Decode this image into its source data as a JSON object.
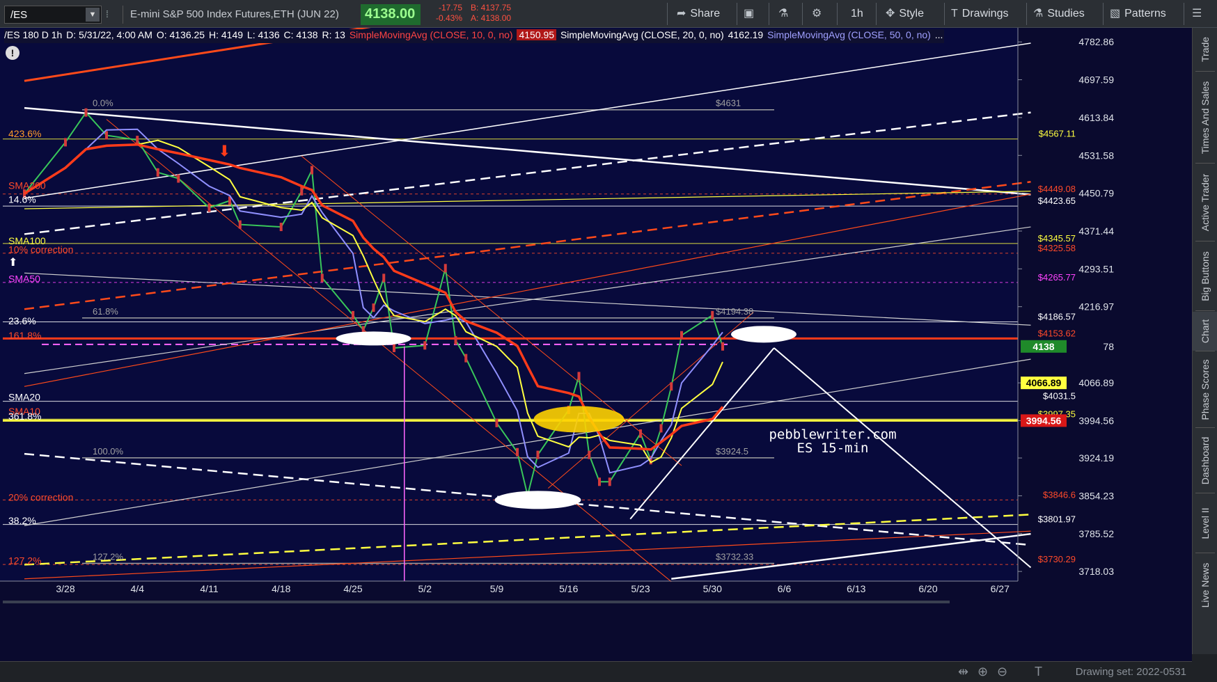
{
  "toolbar": {
    "symbol": "/ES",
    "description": "E-mini S&P 500 Index Futures,ETH (JUN 22)",
    "last": "4138.00",
    "change": "-17.75",
    "change_pct": "-0.43%",
    "bid": "B: 4137.75",
    "ask": "A: 4138.00",
    "share": "Share",
    "timeframe": "1h",
    "style": "Style",
    "drawings": "Drawings",
    "studies": "Studies",
    "patterns": "Patterns"
  },
  "info": {
    "symbol_period": "/ES 180 D 1h",
    "date": "D: 5/31/22, 4:00 AM",
    "open": "O: 4136.25",
    "high": "H: 4149",
    "low": "L: 4136",
    "close": "C: 4138",
    "range": "R: 13",
    "sma10_label": "SimpleMovingAvg (CLOSE, 10, 0, no)",
    "sma10_value": "4150.95",
    "sma20_label": "SimpleMovingAvg (CLOSE, 20, 0, no)",
    "sma20_value": "4162.19",
    "sma50_label": "SimpleMovingAvg (CLOSE, 50, 0, no)"
  },
  "watermark": [
    "pebblewriter.com",
    "ES 15-min"
  ],
  "side_tabs": [
    "Trade",
    "Times And Sales",
    "Active Trader",
    "Big Buttons",
    "Chart",
    "Phase Scores",
    "Dashboard",
    "Level II",
    "Live News"
  ],
  "drawing_set": "Drawing set: 2022-0531",
  "colors": {
    "background": "#080a3c",
    "sma10": "#9090ff",
    "sma20": "#ffff40",
    "sma50": "#ff3b1a",
    "last_price_tag": "#1f8a2a",
    "highlight": "#ffd200"
  },
  "chart_data": {
    "type": "candlestick",
    "x_ticks": [
      "3/28",
      "4/4",
      "4/11",
      "4/18",
      "4/25",
      "5/2",
      "5/9",
      "5/16",
      "5/23",
      "5/30",
      "6/6",
      "6/13",
      "6/20",
      "6/27"
    ],
    "y_ticks": [
      4782.86,
      4697.59,
      4613.84,
      4531.58,
      4450.79,
      4371.44,
      4293.51,
      4216.97,
      4066.89,
      3994.56,
      3924.19,
      3854.23,
      3785.52,
      3718.03
    ],
    "y_scale": "log",
    "ylim": [
      3701,
      4815
    ],
    "xlim": [
      "3/24",
      "6/30"
    ],
    "price_tags": [
      {
        "value": 4138,
        "label": "4138",
        "suffix": "78",
        "color": "#1f8a2a"
      },
      {
        "value": 4066.89,
        "label": "4066.89",
        "color": "#ffff40"
      },
      {
        "value": 3994.56,
        "label": "3994.56",
        "color": "#d81818"
      }
    ],
    "price_series": [
      {
        "date": "3/24",
        "close": 4450
      },
      {
        "date": "3/28",
        "close": 4560
      },
      {
        "date": "3/30",
        "close": 4625
      },
      {
        "date": "4/1",
        "close": 4575
      },
      {
        "date": "4/4",
        "close": 4565
      },
      {
        "date": "4/6",
        "close": 4495
      },
      {
        "date": "4/8",
        "close": 4482
      },
      {
        "date": "4/11",
        "close": 4420
      },
      {
        "date": "4/13",
        "close": 4435
      },
      {
        "date": "4/14",
        "close": 4385
      },
      {
        "date": "4/18",
        "close": 4380
      },
      {
        "date": "4/20",
        "close": 4455
      },
      {
        "date": "4/21",
        "close": 4500
      },
      {
        "date": "4/22",
        "close": 4275
      },
      {
        "date": "4/25",
        "close": 4200
      },
      {
        "date": "4/26",
        "close": 4170
      },
      {
        "date": "4/27",
        "close": 4215
      },
      {
        "date": "4/28",
        "close": 4275
      },
      {
        "date": "4/29",
        "close": 4135
      },
      {
        "date": "5/2",
        "close": 4140
      },
      {
        "date": "5/4",
        "close": 4295
      },
      {
        "date": "5/5",
        "close": 4150
      },
      {
        "date": "5/6",
        "close": 4115
      },
      {
        "date": "5/9",
        "close": 3990
      },
      {
        "date": "5/11",
        "close": 3935
      },
      {
        "date": "5/12",
        "close": 3855
      },
      {
        "date": "5/13",
        "close": 3930
      },
      {
        "date": "5/16",
        "close": 4015
      },
      {
        "date": "5/17",
        "close": 4080
      },
      {
        "date": "5/18",
        "close": 3930
      },
      {
        "date": "5/19",
        "close": 3880
      },
      {
        "date": "5/20",
        "close": 3880
      },
      {
        "date": "5/23",
        "close": 3970
      },
      {
        "date": "5/24",
        "close": 3920
      },
      {
        "date": "5/25",
        "close": 3980
      },
      {
        "date": "5/26",
        "close": 4060
      },
      {
        "date": "5/27",
        "close": 4160
      },
      {
        "date": "5/30",
        "close": 4200
      },
      {
        "date": "5/31",
        "close": 4138
      }
    ],
    "series": [
      {
        "name": "SimpleMovingAvg (CLOSE, 10, 0, no)",
        "color": "#9090ff",
        "last": 4150.95
      },
      {
        "name": "SimpleMovingAvg (CLOSE, 20, 0, no)",
        "color": "#ffff40",
        "last": 4162.19
      },
      {
        "name": "SimpleMovingAvg (CLOSE, 50, 0, no)",
        "color": "#ff3b1a",
        "last": 3994.56
      }
    ],
    "levels": [
      {
        "value": 4567.11,
        "label": "$4567.11",
        "color": "#ffff40"
      },
      {
        "value": 4449.08,
        "label": "$4449.08",
        "color": "#ff4a2a"
      },
      {
        "value": 4423.65,
        "label": "$4423.65",
        "color": "#ffffff"
      },
      {
        "value": 4345.57,
        "label": "$4345.57",
        "color": "#ffff40"
      },
      {
        "value": 4325.58,
        "label": "$4325.58",
        "color": "#ff4a2a"
      },
      {
        "value": 4265.77,
        "label": "$4265.77",
        "color": "#ff44ff"
      },
      {
        "value": 4186.57,
        "label": "$4186.57",
        "color": "#ffffff"
      },
      {
        "value": 4153.62,
        "label": "$4153.62",
        "color": "#ff4a2a"
      },
      {
        "value": 4031.5,
        "label": "$4031.5",
        "color": "#ffffff"
      },
      {
        "value": 3997.35,
        "label": "$3997.35",
        "color": "#ffff40"
      },
      {
        "value": 3846.6,
        "label": "$3846.6",
        "color": "#ff4a2a"
      },
      {
        "value": 3801.97,
        "label": "$3801.97",
        "color": "#ffffff"
      },
      {
        "value": 3730.29,
        "label": "$3730.29",
        "color": "#ff4a2a"
      }
    ],
    "fib": [
      {
        "value": 4631,
        "label": "0.0%",
        "price_label": "$4631"
      },
      {
        "value": 4194.38,
        "label": "61.8%",
        "price_label": "$4194.38"
      },
      {
        "value": 3924.5,
        "label": "100.0%",
        "price_label": "$3924.5"
      },
      {
        "value": 3732.33,
        "label": "127.2%",
        "price_label": "$3732.33"
      }
    ],
    "left_labels": [
      {
        "text": "423.6%",
        "value": 4577,
        "color": "#ff9a2a"
      },
      {
        "text": "SMA200",
        "value": 4466,
        "color": "#ff4a2a"
      },
      {
        "text": "14.6%",
        "value": 4436,
        "color": "#ffffff"
      },
      {
        "text": "SMA100",
        "value": 4350,
        "color": "#ffff40"
      },
      {
        "text": "10% correction",
        "value": 4332,
        "color": "#ff4a2a"
      },
      {
        "text": "SMA50",
        "value": 4272,
        "color": "#ff44ff"
      },
      {
        "text": "23.6%",
        "value": 4187,
        "color": "#ffffff"
      },
      {
        "text": "161.8%",
        "value": 4158,
        "color": "#ff4a2a"
      },
      {
        "text": "SMA20",
        "value": 4038,
        "color": "#ffffff"
      },
      {
        "text": "SMA10",
        "value": 4011,
        "color": "#ff4a2a"
      },
      {
        "text": "361.8%",
        "value": 4002,
        "color": "#ffffff"
      },
      {
        "text": "20% correction",
        "value": 3850,
        "color": "#ff4a2a"
      },
      {
        "text": "38.2%",
        "value": 3808,
        "color": "#ffffff"
      },
      {
        "text": "127.2%",
        "value": 3736,
        "color": "#ff4a2a"
      }
    ]
  }
}
